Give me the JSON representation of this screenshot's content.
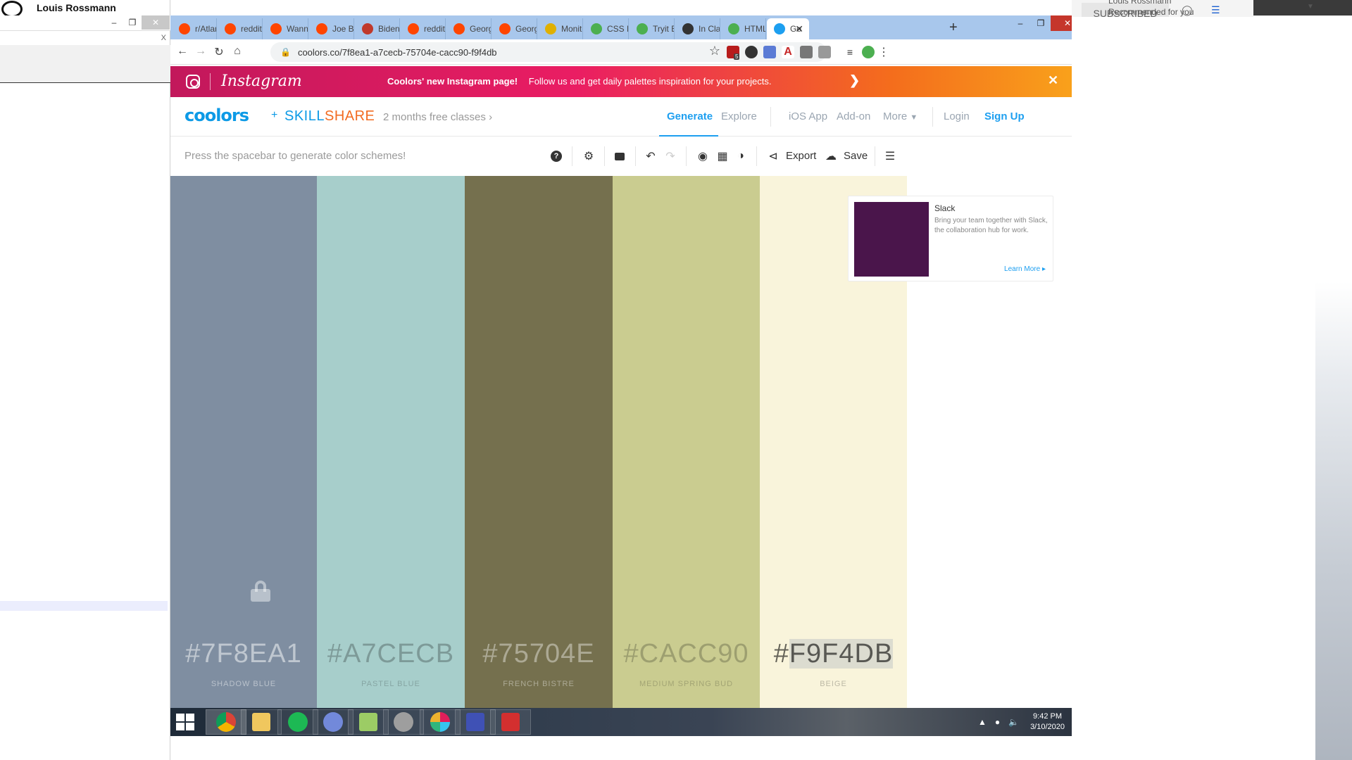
{
  "background": {
    "left_window": {
      "title": "Louis Rossmann",
      "close_x": "X"
    },
    "right_window": {
      "subscribed": "SUBSCRIBED",
      "author": "Louis Rossmann",
      "recommended": "Recommended for you"
    }
  },
  "browser": {
    "tabs": [
      {
        "label": "r/Atlan",
        "icon": "reddit-icon",
        "color": "#ff4500"
      },
      {
        "label": "reddit:",
        "icon": "reddit-icon",
        "color": "#ff4500"
      },
      {
        "label": "Wanna",
        "icon": "reddit-icon",
        "color": "#ff4500"
      },
      {
        "label": "Joe Bid",
        "icon": "reddit-icon",
        "color": "#ff4500"
      },
      {
        "label": "Biden:",
        "icon": "p-icon",
        "color": "#c0392b"
      },
      {
        "label": "reddit:",
        "icon": "reddit-icon",
        "color": "#ff4500"
      },
      {
        "label": "Georgi",
        "icon": "reddit-icon",
        "color": "#ff4500"
      },
      {
        "label": "Georgi",
        "icon": "reddit-icon",
        "color": "#ff4500"
      },
      {
        "label": "Monito",
        "icon": "bee-icon",
        "color": "#e0b000"
      },
      {
        "label": "CSS Di",
        "icon": "w3-icon",
        "color": "#4caf50"
      },
      {
        "label": "Tryit Ec",
        "icon": "w3-icon",
        "color": "#4caf50"
      },
      {
        "label": "In Clas",
        "icon": "github-icon",
        "color": "#333333"
      },
      {
        "label": "HTML",
        "icon": "w3-icon",
        "color": "#4caf50"
      },
      {
        "label": "Ge",
        "icon": "coolors-icon",
        "color": "#1d9ff0"
      }
    ],
    "url": "coolors.co/7f8ea1-a7cecb-75704e-cacc90-f9f4db",
    "ext_badge": "5"
  },
  "banner": {
    "brand": "Instagram",
    "headline": "Coolors' new Instagram page!",
    "message": "Follow us and get daily palettes inspiration for your projects."
  },
  "nav": {
    "logo": "coolors",
    "plus": "+",
    "skill": "SKILL",
    "share": "SHARE",
    "promo": "2 months free classes",
    "generate": "Generate",
    "explore": "Explore",
    "ios_app": "iOS App",
    "addon": "Add-on",
    "more": "More",
    "login": "Login",
    "signup": "Sign Up"
  },
  "generator": {
    "hint": "Press the spacebar to generate color schemes!",
    "export": "Export",
    "save": "Save"
  },
  "palette": [
    {
      "hex": "#7F8EA1",
      "color": "#7f8ea1",
      "name": "SHADOW BLUE",
      "locked": true
    },
    {
      "hex": "#A7CECB",
      "color": "#a7cecb",
      "name": "PASTEL BLUE",
      "locked": false
    },
    {
      "hex": "#75704E",
      "color": "#75704e",
      "name": "FRENCH BISTRE",
      "locked": false
    },
    {
      "hex": "#CACC90",
      "color": "#cacc90",
      "name": "MEDIUM SPRING BUD",
      "locked": false
    },
    {
      "hex_prefix": "#",
      "hex_selected": "F9F4DB",
      "color": "#f9f4db",
      "name": "BEIGE",
      "locked": false
    }
  ],
  "ad": {
    "title": "Slack",
    "description": "Bring your team together with Slack, the collaboration hub for work.",
    "cta": "Learn More"
  },
  "taskbar": {
    "time": "9:42 PM",
    "date": "3/10/2020"
  }
}
